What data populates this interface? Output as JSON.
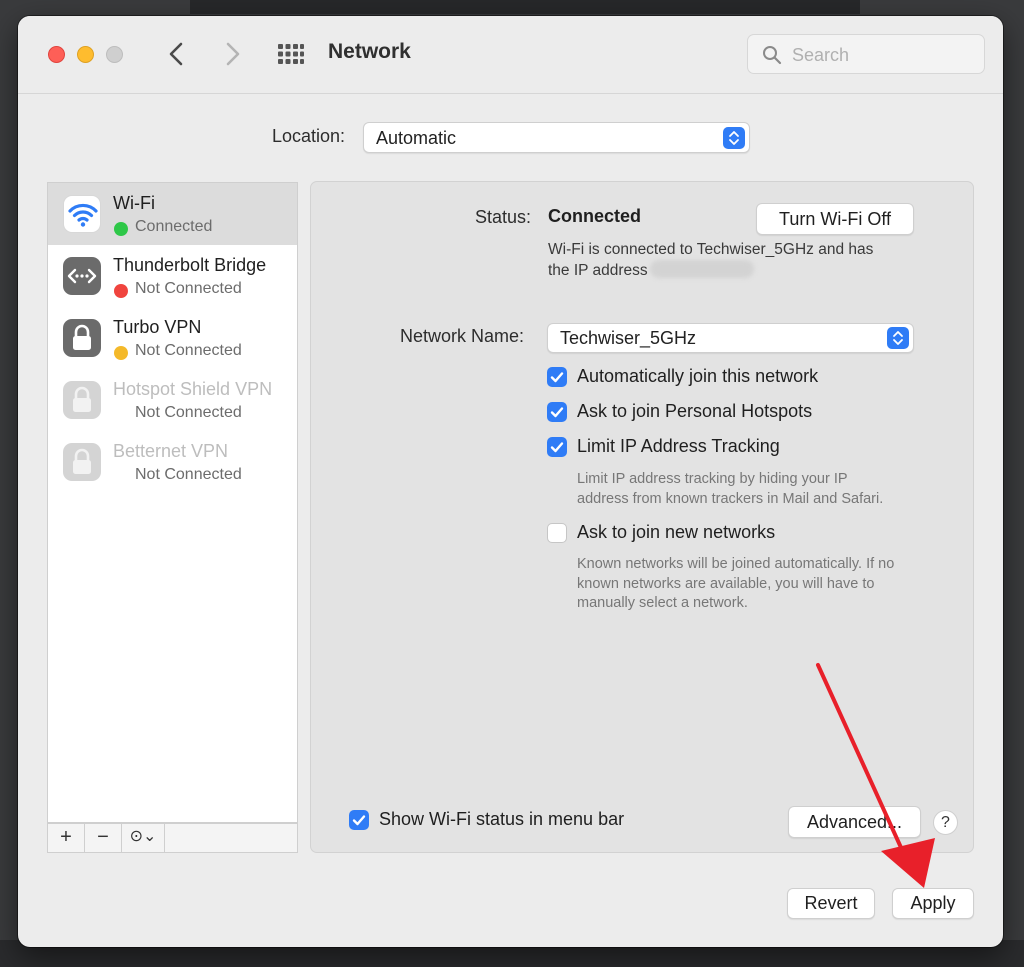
{
  "window": {
    "title": "Network",
    "search_placeholder": "Search"
  },
  "location": {
    "label": "Location:",
    "value": "Automatic"
  },
  "services": [
    {
      "name": "Wi-Fi",
      "status": "Connected",
      "status_color": "#2ec748",
      "icon": "wifi-icon",
      "selected": true,
      "enabled": true
    },
    {
      "name": "Thunderbolt Bridge",
      "status": "Not Connected",
      "status_color": "#f0443e",
      "icon": "thunderbolt-bridge-icon",
      "selected": false,
      "enabled": true
    },
    {
      "name": "Turbo VPN",
      "status": "Not Connected",
      "status_color": "#f4b92a",
      "icon": "lock-icon",
      "selected": false,
      "enabled": true
    },
    {
      "name": "Hotspot Shield VPN",
      "status": "Not Connected",
      "icon": "lock-icon",
      "selected": false,
      "enabled": false
    },
    {
      "name": "Betternet VPN",
      "status": "Not Connected",
      "icon": "lock-icon",
      "selected": false,
      "enabled": false
    }
  ],
  "sidebar_toolbar": {
    "add": "+",
    "remove": "−",
    "action": "⊙⌄"
  },
  "detail": {
    "status_label": "Status:",
    "status_value": "Connected",
    "turn_off_label": "Turn Wi-Fi Off",
    "status_desc_1": "Wi-Fi is connected to Techwiser_5GHz and has",
    "status_desc_2": "the IP address",
    "network_name_label": "Network Name:",
    "network_name_value": "Techwiser_5GHz",
    "options": [
      {
        "label": "Automatically join this network",
        "checked": true
      },
      {
        "label": "Ask to join Personal Hotspots",
        "checked": true
      },
      {
        "label": "Limit IP Address Tracking",
        "checked": true
      },
      {
        "label": "Ask to join new networks",
        "checked": false
      }
    ],
    "limit_ip_hint_1": "Limit IP address tracking by hiding your IP",
    "limit_ip_hint_2": "address from known trackers in Mail and Safari.",
    "new_networks_hint_1": "Known networks will be joined automatically. If no",
    "new_networks_hint_2": "known networks are available, you will have to",
    "new_networks_hint_3": "manually select a network.",
    "show_status_label": "Show Wi-Fi status in menu bar",
    "show_status_checked": true,
    "advanced_label": "Advanced...",
    "help_label": "?"
  },
  "footer": {
    "revert_label": "Revert",
    "apply_label": "Apply"
  },
  "colors": {
    "accent": "#2f7cf6",
    "annotation_arrow": "#e8202a"
  }
}
